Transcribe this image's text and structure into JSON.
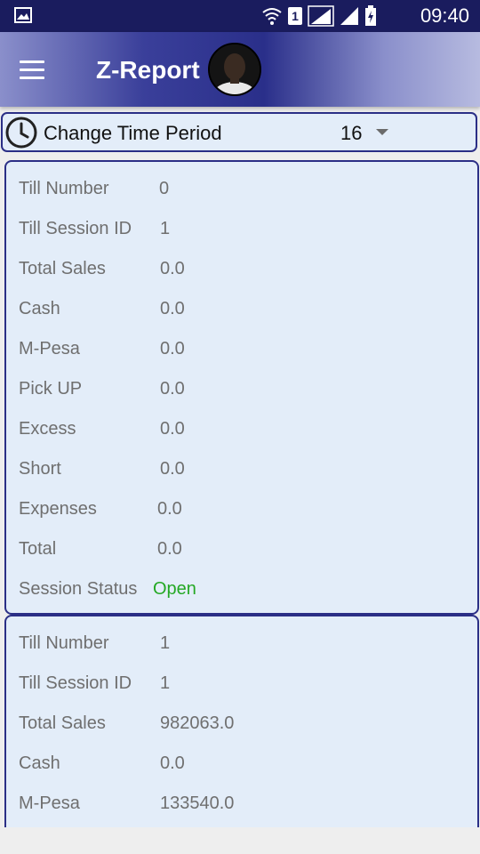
{
  "status_bar": {
    "time": "09:40",
    "sim_label": "1",
    "icons": [
      "gallery-icon",
      "wifi-icon",
      "sim-icon",
      "signal-icon",
      "signal-icon",
      "battery-charging-icon"
    ]
  },
  "app_bar": {
    "title": "Z-Report",
    "icons": [
      "menu-icon",
      "avatar"
    ]
  },
  "period": {
    "label": "Change Time Period",
    "selected_value": "16",
    "icons": [
      "clock-icon",
      "dropdown-arrow-icon"
    ]
  },
  "sessions": [
    {
      "till_number": {
        "label": "Till Number",
        "value": "0"
      },
      "till_session_id": {
        "label": "Till Session ID",
        "value": "1"
      },
      "total_sales": {
        "label": "Total Sales",
        "value": "0.0"
      },
      "cash": {
        "label": "Cash",
        "value": "0.0"
      },
      "mpesa": {
        "label": "M-Pesa",
        "value": "0.0"
      },
      "pick_up": {
        "label": "Pick UP",
        "value": "0.0"
      },
      "excess": {
        "label": "Excess",
        "value": "0.0"
      },
      "short": {
        "label": "Short",
        "value": "0.0"
      },
      "expenses": {
        "label": "Expenses",
        "value": "0.0"
      },
      "total": {
        "label": "Total",
        "value": "0.0"
      },
      "session_status": {
        "label": "Session Status",
        "value": "Open"
      }
    },
    {
      "till_number": {
        "label": "Till Number",
        "value": "1"
      },
      "till_session_id": {
        "label": "Till Session ID",
        "value": "1"
      },
      "total_sales": {
        "label": "Total Sales",
        "value": "982063.0"
      },
      "cash": {
        "label": "Cash",
        "value": "0.0"
      },
      "mpesa": {
        "label": "M-Pesa",
        "value": "133540.0"
      }
    }
  ],
  "colors": {
    "status_bar": "#1a1c5e",
    "app_bar_dark": "#2a2f8a",
    "card_border": "#2b2f86",
    "card_bg": "#e3edf9",
    "text_grey": "#6f6f6f",
    "status_open": "#24a824"
  }
}
